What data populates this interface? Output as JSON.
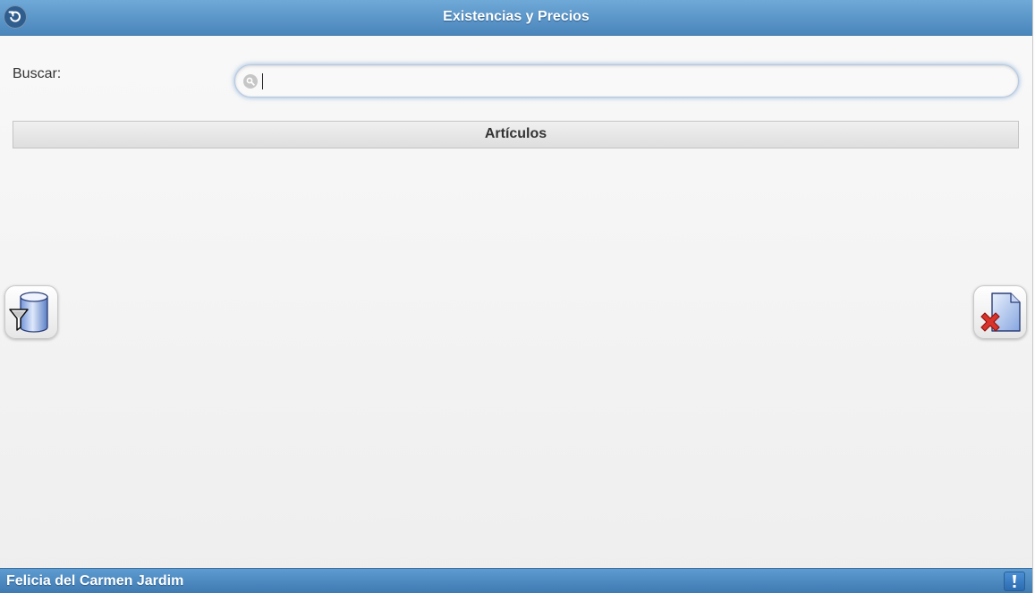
{
  "header": {
    "title": "Existencias y Precios",
    "back_icon": "back-arrow-icon"
  },
  "search": {
    "label": "Buscar:",
    "value": "",
    "placeholder": "",
    "icon": "search-icon"
  },
  "list": {
    "divider_label": "Artículos",
    "items": []
  },
  "actions": {
    "filter_icon": "database-filter-icon",
    "clear_icon": "document-delete-icon"
  },
  "footer": {
    "user_name": "Felicia del Carmen Jardim",
    "alert_icon": "exclamation-icon"
  },
  "colors": {
    "header_blue": "#5a95c9",
    "footer_blue": "#4a88c0",
    "background": "#f4f4f4",
    "focus_glow": "#387ac7"
  }
}
